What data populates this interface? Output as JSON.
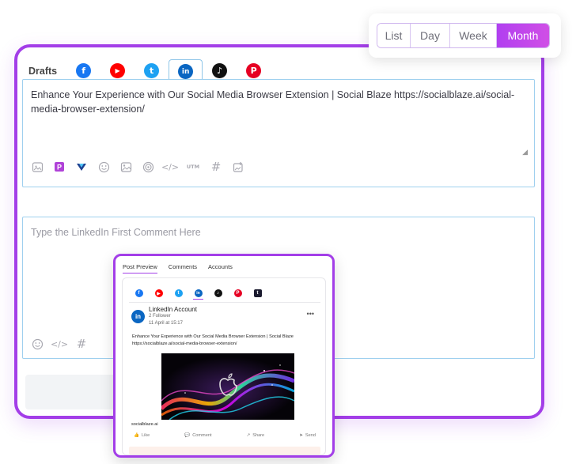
{
  "view_switcher": {
    "options": [
      {
        "label": "List",
        "active": false
      },
      {
        "label": "Day",
        "active": false
      },
      {
        "label": "Week",
        "active": false
      },
      {
        "label": "Month",
        "active": true
      }
    ]
  },
  "composer": {
    "drafts_label": "Drafts",
    "networks": [
      {
        "name": "facebook-icon",
        "glyph": "f",
        "color": "#1877f2",
        "active": false
      },
      {
        "name": "youtube-icon",
        "glyph": "▶",
        "color": "#ff0000",
        "active": false
      },
      {
        "name": "twitter-icon",
        "glyph": "t",
        "color": "#1da1f2",
        "active": false
      },
      {
        "name": "linkedin-icon",
        "glyph": "in",
        "color": "#0a66c2",
        "active": true
      },
      {
        "name": "tiktok-icon",
        "glyph": "♪",
        "color": "#111111",
        "active": false
      },
      {
        "name": "pinterest-icon",
        "glyph": "P",
        "color": "#e60023",
        "active": false
      }
    ],
    "post_text": "Enhance Your Experience with Our Social Media Browser Extension | Social Blaze https://socialblaze.ai/social-media-browser-extension/",
    "toolbar_icons": [
      "ai-assistant-icon",
      "picsart-icon",
      "vista-icon",
      "emoji-icon",
      "image-icon",
      "target-icon",
      "code-icon",
      "utm-icon",
      "hashtag-icon",
      "media-library-icon"
    ],
    "utm_label": "UTM"
  },
  "first_comment": {
    "placeholder": "Type the LinkedIn First Comment Here",
    "toolbar_icons": [
      "emoji-icon",
      "code-icon",
      "hashtag-icon"
    ]
  },
  "preview": {
    "tabs": [
      {
        "label": "Post Preview",
        "active": true
      },
      {
        "label": "Comments",
        "active": false
      },
      {
        "label": "Accounts",
        "active": false
      }
    ],
    "networks": [
      {
        "name": "facebook-icon",
        "glyph": "f",
        "color": "#1877f2",
        "active": false
      },
      {
        "name": "youtube-icon",
        "glyph": "▶",
        "color": "#ff0000",
        "active": false
      },
      {
        "name": "twitter-icon",
        "glyph": "t",
        "color": "#1da1f2",
        "active": false
      },
      {
        "name": "linkedin-icon",
        "glyph": "in",
        "color": "#0a66c2",
        "active": true
      },
      {
        "name": "tiktok-icon",
        "glyph": "♪",
        "color": "#111111",
        "active": false
      },
      {
        "name": "pinterest-icon",
        "glyph": "P",
        "color": "#e60023",
        "active": false
      },
      {
        "name": "tumblr-icon",
        "glyph": "t",
        "color": "#1b1b2f",
        "active": false
      }
    ],
    "account_name": "LinkedIn Account",
    "followers": "2 Follower",
    "timestamp": "11 April at 15:17",
    "post_text": "Enhance Your Experience with Our Social Media Browser Extension | Social Blaze https://socialblaze.ai/social-media-browser-extension/",
    "link_domain": "socialblaze.ai",
    "actions": [
      {
        "label": "Like",
        "icon": "like-icon",
        "glyph": "👍"
      },
      {
        "label": "Comment",
        "icon": "comment-icon",
        "glyph": "💬"
      },
      {
        "label": "Share",
        "icon": "share-icon",
        "glyph": "↗"
      },
      {
        "label": "Send",
        "icon": "send-icon",
        "glyph": "➤"
      }
    ]
  }
}
